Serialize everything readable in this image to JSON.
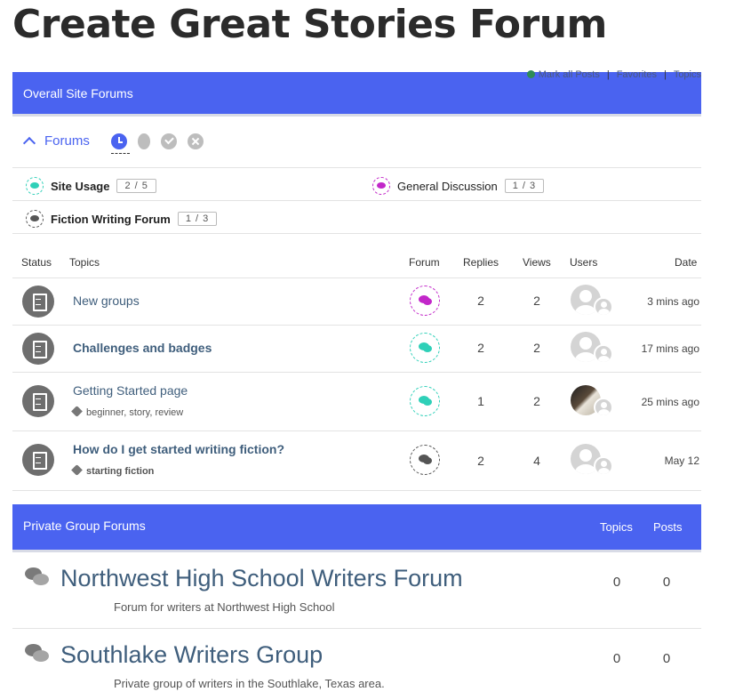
{
  "page_title": "Create Great Stories Forum",
  "overall_bar": {
    "title": "Overall Site Forums",
    "links": [
      "Mark all Posts",
      "Favorites",
      "Topics"
    ]
  },
  "forums_toggle_label": "Forums",
  "filter_icons": [
    "clock-icon",
    "flame-icon",
    "check-icon",
    "close-icon"
  ],
  "forum_list": [
    {
      "name": "Site Usage",
      "count": "2 / 5",
      "color": "#2fd0b8"
    },
    {
      "name": "General Discussion",
      "count": "1 / 3",
      "color": "#c227c9"
    },
    {
      "name": "Fiction Writing Forum",
      "count": "1 / 3",
      "color": "#555555"
    }
  ],
  "topics_table": {
    "headers": {
      "status": "Status",
      "topics": "Topics",
      "forum": "Forum",
      "replies": "Replies",
      "views": "Views",
      "users": "Users",
      "date": "Date"
    },
    "rows": [
      {
        "title": "New groups",
        "tags": "",
        "replies": "2",
        "views": "2",
        "date": "3 mins ago"
      },
      {
        "title": "Challenges and badges",
        "tags": "",
        "replies": "2",
        "views": "2",
        "date": "17 mins ago"
      },
      {
        "title": "Getting Started page",
        "tags": "beginner, story, review",
        "replies": "1",
        "views": "2",
        "date": "25 mins ago"
      },
      {
        "title": "How do I get started writing fiction?",
        "tags": "starting fiction",
        "replies": "2",
        "views": "4",
        "date": "May 12"
      }
    ]
  },
  "private_bar": {
    "title": "Private Group Forums",
    "col_topics": "Topics",
    "col_posts": "Posts"
  },
  "groups": [
    {
      "title": "Northwest High School Writers Forum",
      "desc": "Forum for writers at Northwest High School",
      "topics": "0",
      "posts": "0"
    },
    {
      "title": "Southlake Writers Group",
      "desc": "Private group of writers in the Southlake, Texas area.",
      "topics": "0",
      "posts": "0"
    }
  ],
  "colors": {
    "accent": "#4a63f0",
    "link": "#3f5e7c",
    "teal": "#2fd0b8",
    "purple": "#c227c9"
  }
}
